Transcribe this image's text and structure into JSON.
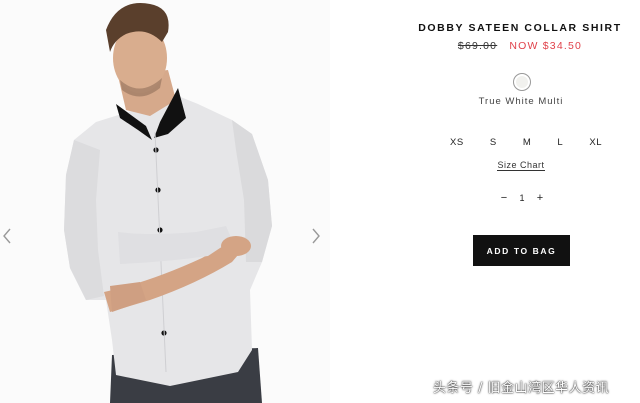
{
  "product": {
    "title": "DOBBY SATEEN COLLAR SHIRT",
    "old_price": "$69.00",
    "now_label": "NOW",
    "now_price": "$34.50"
  },
  "color": {
    "name": "True White Multi",
    "swatch_hex": "#f1f1ee"
  },
  "sizes": [
    "XS",
    "S",
    "M",
    "L",
    "XL"
  ],
  "size_chart_label": "Size Chart",
  "quantity": {
    "minus": "−",
    "value": "1",
    "plus": "+"
  },
  "add_to_bag_label": "ADD TO BAG",
  "gallery": {
    "prev_icon": "chevron-left-icon",
    "next_icon": "chevron-right-icon",
    "image": "model-wearing-shirt"
  },
  "watermark": "头条号 / 旧金山湾区华人资讯",
  "colors": {
    "sale": "#e0414a",
    "button_bg": "#111111"
  }
}
